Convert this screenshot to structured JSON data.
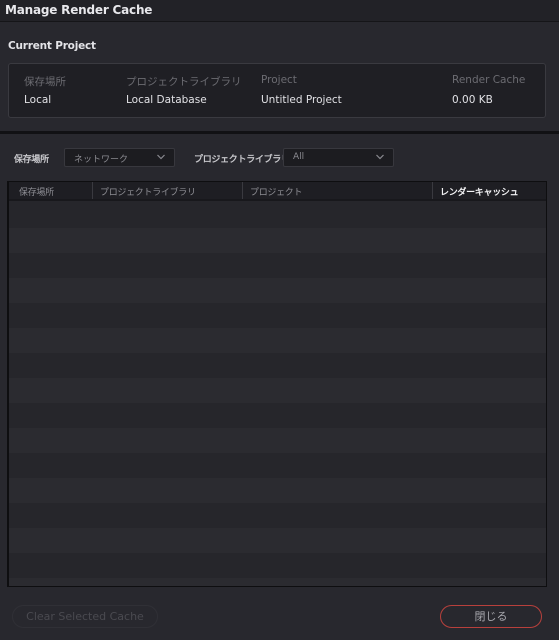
{
  "window": {
    "title": "Manage Render Cache"
  },
  "current_project": {
    "section_title": "Current Project",
    "columns": [
      {
        "label": "保存場所",
        "value": "Local"
      },
      {
        "label": "プロジェクトライブラリ",
        "value": "Local Database"
      },
      {
        "label": "Project",
        "value": "Untitled Project"
      },
      {
        "label": "Render Cache",
        "value": "0.00 KB"
      }
    ]
  },
  "filters": {
    "location_label": "保存場所",
    "location_value": "ネットワーク",
    "library_label": "プロジェクトライブラリ",
    "library_value": "All"
  },
  "table": {
    "columns": [
      {
        "label": "保存場所",
        "active": false
      },
      {
        "label": "プロジェクトライブラリ",
        "active": false
      },
      {
        "label": "プロジェクト",
        "active": false
      },
      {
        "label": "レンダーキャッシュ",
        "active": true
      }
    ],
    "rows": []
  },
  "buttons": {
    "clear_label": "Clear Selected Cache",
    "clear_enabled": false,
    "close_label": "閉じる"
  },
  "colors": {
    "accent_close_border": "#b8403c",
    "background": "#28282e"
  }
}
